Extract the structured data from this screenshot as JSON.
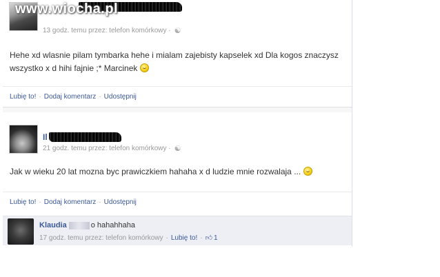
{
  "watermark": "www.wiocha.pl",
  "posts": [
    {
      "author": "",
      "meta": "13 godz. temu przez: telefon komórkowy ·",
      "body": "Hehe xd wlasnie pilam tymbarka hehe i mialam zajebisty kapselek xd Dla kogos znaczysz wszystko x d hihi fajnie ;* Marcinek",
      "actions": {
        "like": "Lubię to!",
        "comment": "Dodaj komentarz",
        "share": "Udostępnij"
      }
    },
    {
      "author": "Il",
      "meta": "21 godz. temu przez: telefon komórkowy ·",
      "body": "Jak w wieku 20 lat mozna byc prawiczkiem hahaha x d ludzie mnie rozwalaja ...",
      "actions": {
        "like": "Lubię to!",
        "comment": "Dodaj komentarz",
        "share": "Udostępnij"
      }
    }
  ],
  "comment": {
    "author": "Klaudia",
    "text": "o hahahhaha",
    "meta": "17 godz. temu przez: telefon komórkowy",
    "like": "Lubię to!",
    "like_count": "1"
  },
  "separator": "·",
  "icons": {
    "privacy": "globe-icon",
    "smiley": "smiley-emoji-icon",
    "like_thumb": "thumbs-up-icon"
  },
  "colors": {
    "link": "#3b5998",
    "meta": "#999999",
    "comment_bg": "#edeff4"
  }
}
